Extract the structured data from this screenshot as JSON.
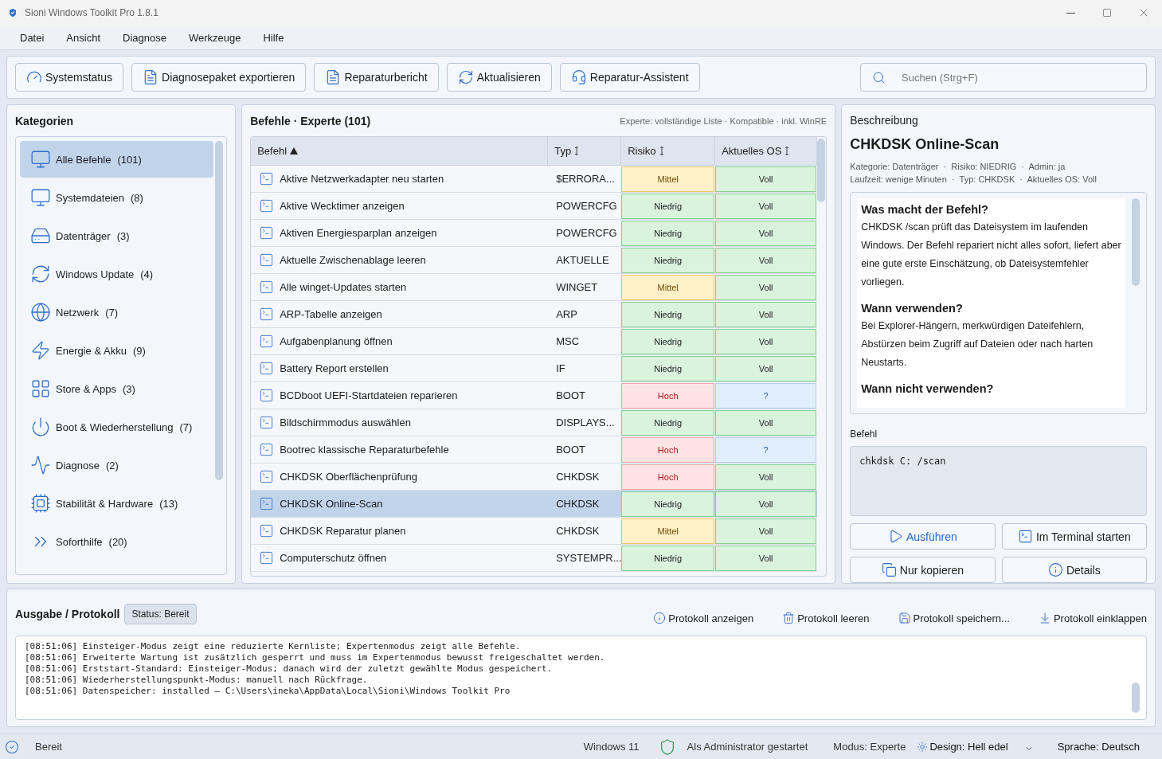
{
  "window": {
    "title": "Sioni Windows Toolkit Pro 1.8.1"
  },
  "menu": [
    "Datei",
    "Ansicht",
    "Diagnose",
    "Werkzeuge",
    "Hilfe"
  ],
  "toolbar": {
    "buttons": [
      "Systemstatus",
      "Diagnosepaket exportieren",
      "Reparaturbericht",
      "Aktualisieren",
      "Reparatur-Assistent"
    ],
    "search": {
      "placeholder": "Suchen (Strg+F)"
    }
  },
  "categories": {
    "title": "Kategorien",
    "items": [
      {
        "label": "Alle Befehle",
        "count": "(101)",
        "selected": true
      },
      {
        "label": "Systemdateien",
        "count": "(8)",
        "selected": false
      },
      {
        "label": "Datenträger",
        "count": "(3)",
        "selected": false
      },
      {
        "label": "Windows Update",
        "count": "(4)",
        "selected": false
      },
      {
        "label": "Netzwerk",
        "count": "(7)",
        "selected": false
      },
      {
        "label": "Energie & Akku",
        "count": "(9)",
        "selected": false
      },
      {
        "label": "Store & Apps",
        "count": "(3)",
        "selected": false
      },
      {
        "label": "Boot & Wiederherstellung",
        "count": "(7)",
        "selected": false
      },
      {
        "label": "Diagnose",
        "count": "(2)",
        "selected": false
      },
      {
        "label": "Stabilität & Hardware",
        "count": "(13)",
        "selected": false
      },
      {
        "label": "Soforthilfe",
        "count": "(20)",
        "selected": false
      }
    ]
  },
  "commands": {
    "title": "Befehle · Experte (101)",
    "note": "Experte: vollständige Liste · Kompatible · inkl. WinRE",
    "columns": [
      {
        "label": "Befehl",
        "sorted": true
      },
      {
        "label": "Typ",
        "sorted": false
      },
      {
        "label": "Risiko",
        "sorted": false
      },
      {
        "label": "Aktuelles OS",
        "sorted": false
      }
    ],
    "rows": [
      {
        "name": "Aktive Netzwerkadapter neu starten",
        "type": "$ERRORA...",
        "risk": {
          "text": "Mittel",
          "kind": "medium"
        },
        "os": {
          "text": "Voll",
          "kind": "full"
        },
        "selected": false
      },
      {
        "name": "Aktive Wecktimer anzeigen",
        "type": "POWERCFG",
        "risk": {
          "text": "Niedrig",
          "kind": "low"
        },
        "os": {
          "text": "Voll",
          "kind": "full"
        },
        "selected": false
      },
      {
        "name": "Aktiven Energiesparplan anzeigen",
        "type": "POWERCFG",
        "risk": {
          "text": "Niedrig",
          "kind": "low"
        },
        "os": {
          "text": "Voll",
          "kind": "full"
        },
        "selected": false
      },
      {
        "name": "Aktuelle Zwischenablage leeren",
        "type": "AKTUELLE",
        "risk": {
          "text": "Niedrig",
          "kind": "low"
        },
        "os": {
          "text": "Voll",
          "kind": "full"
        },
        "selected": false
      },
      {
        "name": "Alle winget-Updates starten",
        "type": "WINGET",
        "risk": {
          "text": "Mittel",
          "kind": "medium"
        },
        "os": {
          "text": "Voll",
          "kind": "full"
        },
        "selected": false
      },
      {
        "name": "ARP-Tabelle anzeigen",
        "type": "ARP",
        "risk": {
          "text": "Niedrig",
          "kind": "low"
        },
        "os": {
          "text": "Voll",
          "kind": "full"
        },
        "selected": false
      },
      {
        "name": "Aufgabenplanung öffnen",
        "type": "MSC",
        "risk": {
          "text": "Niedrig",
          "kind": "low"
        },
        "os": {
          "text": "Voll",
          "kind": "full"
        },
        "selected": false
      },
      {
        "name": "Battery Report erstellen",
        "type": "IF",
        "risk": {
          "text": "Niedrig",
          "kind": "low"
        },
        "os": {
          "text": "Voll",
          "kind": "full"
        },
        "selected": false
      },
      {
        "name": "BCDboot UEFI-Startdateien reparieren",
        "type": "BOOT",
        "risk": {
          "text": "Hoch",
          "kind": "high"
        },
        "os": {
          "text": "?",
          "kind": "unknown"
        },
        "selected": false
      },
      {
        "name": "Bildschirmmodus auswählen",
        "type": "DISPLAYS...",
        "risk": {
          "text": "Niedrig",
          "kind": "low"
        },
        "os": {
          "text": "Voll",
          "kind": "full"
        },
        "selected": false
      },
      {
        "name": "Bootrec klassische Reparaturbefehle",
        "type": "BOOT",
        "risk": {
          "text": "Hoch",
          "kind": "high"
        },
        "os": {
          "text": "?",
          "kind": "unknown"
        },
        "selected": false
      },
      {
        "name": "CHKDSK Oberflächenprüfung",
        "type": "CHKDSK",
        "risk": {
          "text": "Hoch",
          "kind": "high"
        },
        "os": {
          "text": "Voll",
          "kind": "full"
        },
        "selected": false
      },
      {
        "name": "CHKDSK Online-Scan",
        "type": "CHKDSK",
        "risk": {
          "text": "Niedrig",
          "kind": "low"
        },
        "os": {
          "text": "Voll",
          "kind": "full"
        },
        "selected": true
      },
      {
        "name": "CHKDSK Reparatur planen",
        "type": "CHKDSK",
        "risk": {
          "text": "Mittel",
          "kind": "medium"
        },
        "os": {
          "text": "Voll",
          "kind": "full"
        },
        "selected": false
      },
      {
        "name": "Computerschutz öffnen",
        "type": "SYSTEMPR...",
        "risk": {
          "text": "Niedrig",
          "kind": "low"
        },
        "os": {
          "text": "Voll",
          "kind": "full"
        },
        "selected": false
      }
    ]
  },
  "description": {
    "title": "Beschreibung",
    "name": "CHKDSK Online-Scan",
    "meta": [
      "Kategorie: Datenträger  ·  Risiko: NIEDRIG  ·  Admin: ja",
      "Laufzeit: wenige Minuten  ·  Typ: CHKDSK  ·  Aktuelles OS: Voll"
    ],
    "sections": [
      {
        "heading": "Was macht der Befehl?",
        "text": "CHKDSK /scan prüft das Dateisystem im laufenden Windows. Der Befehl repariert nicht alles sofort, liefert aber eine gute erste Einschätzung, ob Dateisystemfehler vorliegen."
      },
      {
        "heading": "Wann verwenden?",
        "text": "Bei Explorer-Hängern, merkwürdigen Dateifehlern, Abstürzen beim Zugriff auf Dateien oder nach harten Neustarts."
      },
      {
        "heading": "Wann nicht verwenden?"
      }
    ],
    "command_label": "Befehl",
    "command": "chkdsk C: /scan",
    "buttons": [
      {
        "label": "Ausführen",
        "kind": "primary"
      },
      {
        "label": "Im Terminal starten",
        "kind": "normal"
      },
      {
        "label": "Nur kopieren",
        "kind": "normal"
      },
      {
        "label": "Details",
        "kind": "normal"
      }
    ]
  },
  "output": {
    "title": "Ausgabe / Protokoll",
    "status": "Status: Bereit",
    "actions": [
      "Protokoll anzeigen",
      "Protokoll leeren",
      "Protokoll speichern...",
      "Protokoll einklappen"
    ],
    "log": [
      "[08:51:06] Einsteiger-Modus zeigt eine reduzierte Kernliste; Expertenmodus zeigt alle Befehle.",
      "[08:51:06] Erweiterte Wartung ist zusätzlich gesperrt und muss im Expertenmodus bewusst freigeschaltet werden.",
      "[08:51:06] Erststart-Standard: Einsteiger-Modus; danach wird der zuletzt gewählte Modus gespeichert.",
      "[08:51:06] Wiederherstellungspunkt-Modus: manuell nach Rückfrage.",
      "[08:51:06] Datenspeicher: installed – C:\\Users\\ineka\\AppData\\Local\\Sioni\\Windows Toolkit Pro"
    ]
  },
  "status_bar": {
    "status": "Bereit",
    "os": "Windows 11",
    "admin": "Als Administrator gestartet",
    "mode": "Modus: Experte",
    "design": "Design: Hell edel",
    "language": "Sprache: Deutsch"
  }
}
